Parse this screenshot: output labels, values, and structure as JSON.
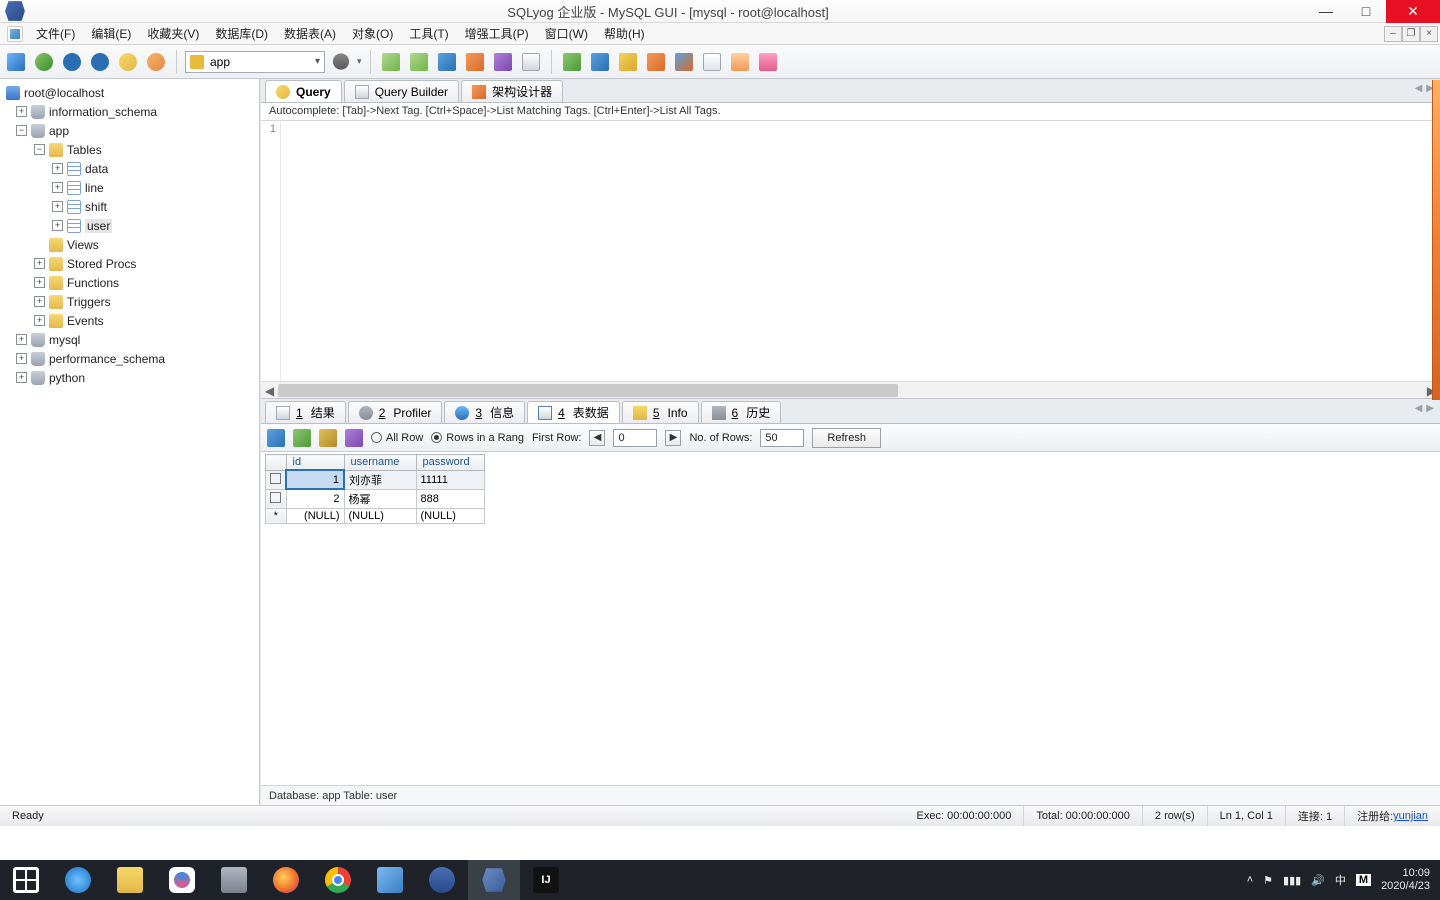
{
  "titlebar": {
    "title": "SQLyog 企业版 - MySQL GUI - [mysql - root@localhost]"
  },
  "menus": [
    "文件(F)",
    "编辑(E)",
    "收藏夹(V)",
    "数据库(D)",
    "数据表(A)",
    "对象(O)",
    "工具(T)",
    "增强工具(P)",
    "窗口(W)",
    "帮助(H)"
  ],
  "toolbar": {
    "db_selected": "app"
  },
  "tree": {
    "host": "root@localhost",
    "databases": [
      {
        "name": "information_schema"
      },
      {
        "name": "app",
        "expanded": true,
        "children": [
          {
            "name": "Tables",
            "type": "folder",
            "expanded": true,
            "children": [
              {
                "name": "data",
                "type": "table"
              },
              {
                "name": "line",
                "type": "table"
              },
              {
                "name": "shift",
                "type": "table"
              },
              {
                "name": "user",
                "type": "table",
                "selected": true
              }
            ]
          },
          {
            "name": "Views",
            "type": "folder"
          },
          {
            "name": "Stored Procs",
            "type": "folder"
          },
          {
            "name": "Functions",
            "type": "folder"
          },
          {
            "name": "Triggers",
            "type": "folder"
          },
          {
            "name": "Events",
            "type": "folder"
          }
        ]
      },
      {
        "name": "mysql"
      },
      {
        "name": "performance_schema"
      },
      {
        "name": "python"
      }
    ]
  },
  "worktabs": [
    {
      "label": "Query",
      "active": true
    },
    {
      "label": "Query Builder"
    },
    {
      "label": "架构设计器"
    }
  ],
  "hint": "Autocomplete: [Tab]->Next Tag. [Ctrl+Space]->List Matching Tags. [Ctrl+Enter]->List All Tags.",
  "editor": {
    "line1": "1"
  },
  "restabs": [
    {
      "num": "1",
      "label": "结果"
    },
    {
      "num": "2",
      "label": "Profiler"
    },
    {
      "num": "3",
      "label": "信息"
    },
    {
      "num": "4",
      "label": "表数据",
      "active": true
    },
    {
      "num": "5",
      "label": "Info"
    },
    {
      "num": "6",
      "label": "历史"
    }
  ],
  "rtool": {
    "allrow": "All Row",
    "rowsrange": "Rows in a Rang",
    "firstrow": "First Row:",
    "firstrow_val": "0",
    "noofrows": "No. of Rows:",
    "noofrows_val": "50",
    "refresh": "Refresh"
  },
  "table": {
    "cols": [
      "id",
      "username",
      "password"
    ],
    "rows": [
      {
        "id": "1",
        "username": "刘亦菲",
        "password": "11111",
        "selected": true
      },
      {
        "id": "2",
        "username": "杨幂",
        "password": "888"
      }
    ],
    "nullrow": {
      "sym": "*",
      "v": "(NULL)"
    }
  },
  "dbinfo": "Database: app Table: user",
  "status": {
    "ready": "Ready",
    "exec": "Exec: 00:00:00:000",
    "total": "Total: 00:00:00:000",
    "rows": "2 row(s)",
    "pos": "Ln 1, Col 1",
    "conn": "连接: 1",
    "reg_lbl": "注册给: ",
    "reg_user": "yunjian"
  },
  "tray": {
    "time": "10:09",
    "date": "2020/4/23",
    "ime": "中",
    "brand": "M"
  }
}
